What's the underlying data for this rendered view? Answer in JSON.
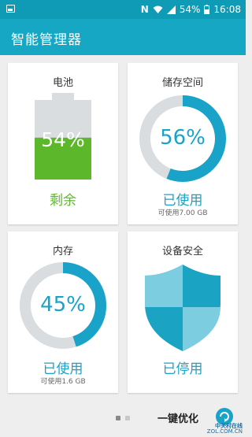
{
  "status_bar": {
    "battery_percent": "54%",
    "time": "16:08"
  },
  "app": {
    "title": "智能管理器"
  },
  "cards": {
    "battery": {
      "title": "电池",
      "value": "54%",
      "status": "剩余",
      "fill": 0.54
    },
    "storage": {
      "title": "储存空间",
      "value": "56%",
      "status": "已使用",
      "sub": "可使用7.00 GB",
      "fill": 0.56
    },
    "memory": {
      "title": "内存",
      "value": "45%",
      "status": "已使用",
      "sub": "可使用1.6 GB",
      "fill": 0.45
    },
    "security": {
      "title": "设备安全",
      "status": "已停用"
    }
  },
  "bottom_bar": {
    "optimize_label": "一键优化",
    "page_count": 2,
    "active_page": 1
  },
  "watermark": {
    "line1": "中关村在线",
    "line2": "ZOL.COM.CN"
  },
  "colors": {
    "header": "#16a7c4",
    "accent": "#1aa3c8",
    "battery_green": "#5cb82a",
    "track": "#d9dde0"
  }
}
